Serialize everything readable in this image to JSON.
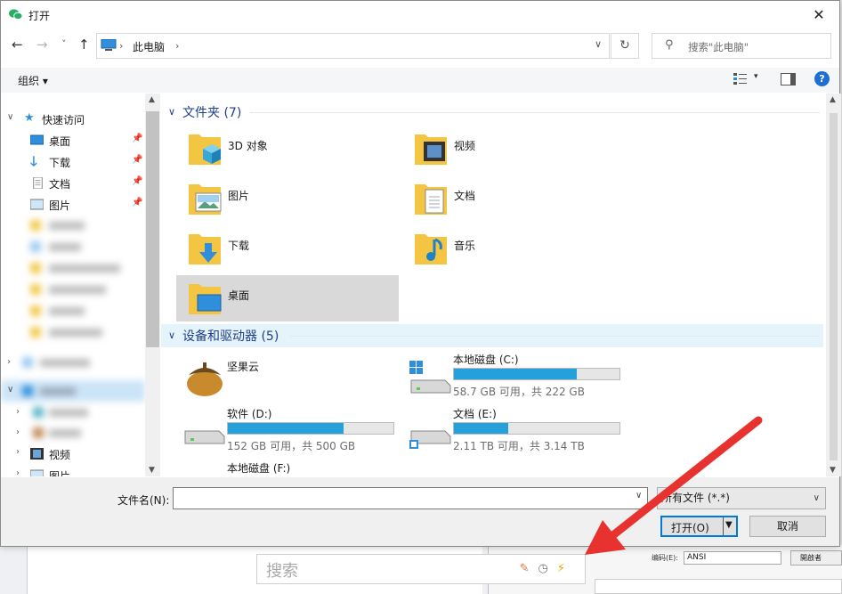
{
  "window": {
    "title": "打开",
    "close": "✕"
  },
  "nav": {
    "back": "←",
    "forward": "→",
    "recent": "˅",
    "up": "↑"
  },
  "address": {
    "crumb": "此电脑",
    "sep": "›",
    "refresh": "↻"
  },
  "search": {
    "placeholder": "搜索\"此电脑\""
  },
  "command_bar": {
    "organize": "组织 ▾",
    "help": "?",
    "view_dd": "▾"
  },
  "sidebar": {
    "quick_access": "快速访问",
    "items": [
      {
        "label": "桌面"
      },
      {
        "label": "下载"
      },
      {
        "label": "文档"
      },
      {
        "label": "图片"
      }
    ],
    "videos": "视频",
    "pictures": "图片"
  },
  "folders_group": {
    "title": "文件夹 (7)"
  },
  "folders": [
    {
      "label": "3D 对象"
    },
    {
      "label": "视频"
    },
    {
      "label": "图片"
    },
    {
      "label": "文档"
    },
    {
      "label": "下载"
    },
    {
      "label": "音乐"
    },
    {
      "label": "桌面"
    }
  ],
  "drives_group": {
    "title": "设备和驱动器 (5)"
  },
  "drives": [
    {
      "name": "坚果云",
      "free": "",
      "used_fraction": null
    },
    {
      "name": "本地磁盘 (C:)",
      "free": "58.7 GB 可用，共 222 GB",
      "used_fraction": 0.74
    },
    {
      "name": "软件 (D:)",
      "free": "152 GB 可用，共 500 GB",
      "used_fraction": 0.7
    },
    {
      "name": "文档 (E:)",
      "free": "2.11 TB 可用，共 3.14 TB",
      "used_fraction": 0.33
    },
    {
      "name": "本地磁盘 (F:)",
      "free": "",
      "used_fraction": null
    }
  ],
  "footer": {
    "filename_label": "文件名(N):",
    "filename_value": "",
    "filetype": "所有文件 (*.*)",
    "open": "打开(O)",
    "cancel": "取消"
  },
  "background_app": {
    "search_placeholder": "搜索",
    "encoding_label": "编码(E):",
    "encoding_value": "ANSI",
    "button": "開啟者"
  },
  "colors": {
    "accent": "#0078d7",
    "drive_fill": "#26a0da",
    "group_title": "#1e3f8a",
    "arrow": "#e8322f"
  }
}
